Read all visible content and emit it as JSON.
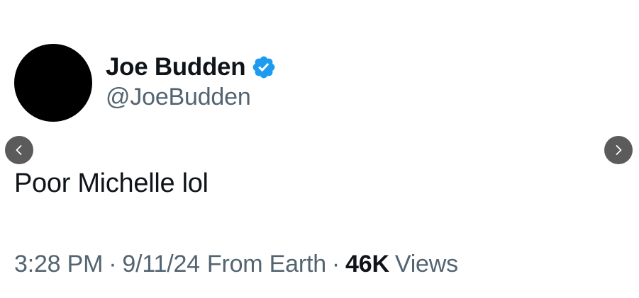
{
  "user": {
    "display_name": "Joe Budden",
    "handle": "@JoeBudden",
    "verified_icon": "verified-badge-icon",
    "avatar_color": "#000000"
  },
  "tweet": {
    "text": "Poor Michelle lol"
  },
  "meta": {
    "time": "3:28 PM",
    "separator": "·",
    "date": "9/11/24",
    "source": "From Earth",
    "views_count": "46K",
    "views_label": "Views"
  },
  "nav": {
    "prev_icon": "chevron-left-icon",
    "next_icon": "chevron-right-icon"
  },
  "colors": {
    "verified_blue": "#1d9bf0",
    "text_primary": "#0f1419",
    "text_secondary": "#536471",
    "nav_button": "#5b5b5b"
  }
}
